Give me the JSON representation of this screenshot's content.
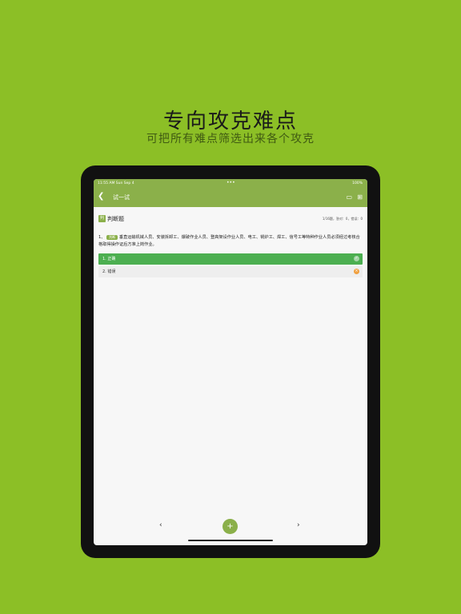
{
  "promo": {
    "title": "专向攻克难点",
    "subtitle": "可把所有难点筛选出来各个攻克"
  },
  "statusbar": {
    "time": "11:55 AM  Sun Sep 4",
    "dots": "•••",
    "battery": "100%"
  },
  "navbar": {
    "title": "试一试",
    "back_icon": "chevron-left-icon",
    "action1_icon": "card-icon",
    "action2_icon": "grid-icon"
  },
  "question": {
    "type_tag": "判",
    "type_label": "判断题",
    "stats": "1/16题，答对：0，错误：0",
    "number": "1、",
    "badge": "判断",
    "text": "垂直运输机械人员、安装拆卸工、爆破作业人员、登高架设作业人员、电工、锅炉工、焊工、信号工等特种作业人员必须经过考核合格取得操作证后方准上岗作业。",
    "options": [
      {
        "label": "1. 正确",
        "icon": "check-icon"
      },
      {
        "label": "2. 错误",
        "icon": "cross-icon"
      }
    ]
  },
  "bottom": {
    "prev": "‹",
    "add": "+",
    "next": "›"
  }
}
